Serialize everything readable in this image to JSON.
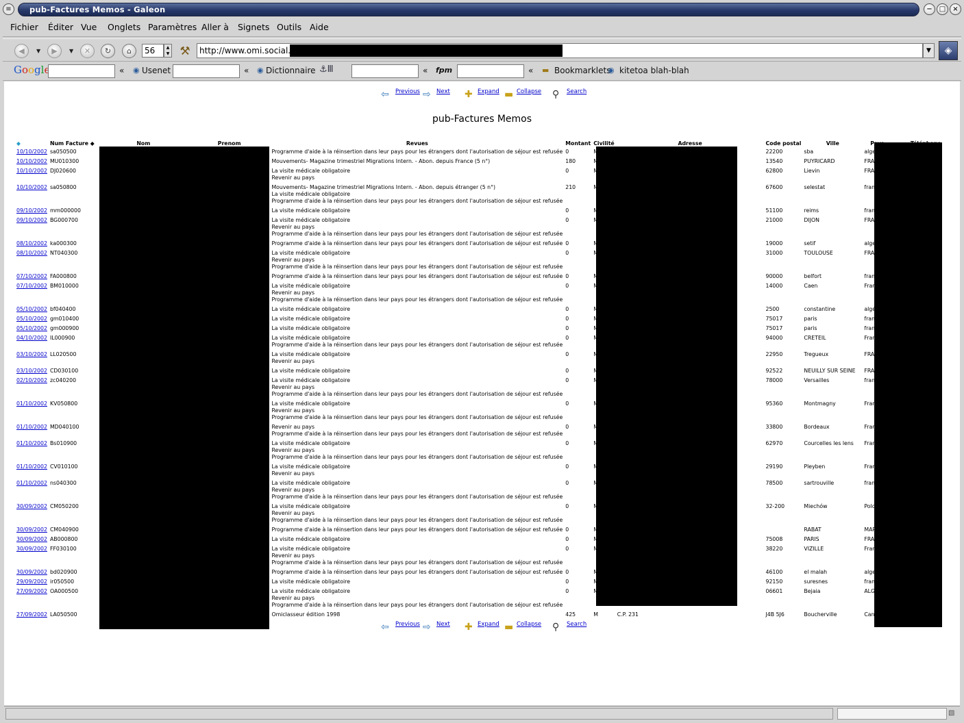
{
  "window": {
    "title": "pub-Factures Memos - Galeon"
  },
  "menu": [
    "Fichier",
    "Éditer",
    "Vue",
    "Onglets",
    "Paramètres",
    "Aller à",
    "Signets",
    "Outils",
    "Aide"
  ],
  "toolbar": {
    "zoom": "56",
    "url": "http://www.omi.social.fr/"
  },
  "bookmarks": {
    "google": "Google",
    "usenet": "Usenet",
    "dictionnaire": "Dictionnaire",
    "fpm": "fpm",
    "chevron": "«",
    "bookmarklets": "Bookmarklets",
    "kitetoa": "kitetoa blah-blah"
  },
  "nav": {
    "previous": "Previous",
    "next": "Next",
    "expand": "Expand",
    "collapse": "Collapse",
    "search": "Search"
  },
  "page_title": "pub-Factures Memos",
  "columns": {
    "num": "Num Facture",
    "nom": "Nom",
    "prenom": "Prenom",
    "revues": "Revues",
    "montant": "Montant",
    "civilite": "Civilité",
    "adresse": "Adresse",
    "cp": "Code postal",
    "ville": "Ville",
    "pays": "Pays",
    "tel": "Téléphone"
  },
  "rows": [
    {
      "date": "10/10/2002",
      "num": "sa050500",
      "revues": [
        "Programme d'aide à la réinsertion dans leur pays pour les étrangers dont l'autorisation de séjour est refusée"
      ],
      "montant": "0",
      "civ": "M",
      "cp": "22200",
      "ville": "sba",
      "pays": "algerie"
    },
    {
      "date": "10/10/2002",
      "num": "MU010300",
      "revues": [
        "Mouvements- Magazine trimestriel Migrations Intern. - Abon. depuis France (5 n°)"
      ],
      "montant": "180",
      "civ": "M",
      "cp": "13540",
      "ville": "PUYRICARD",
      "pays": "FRANCE"
    },
    {
      "date": "10/10/2002",
      "num": "DJ020600",
      "revues": [
        "La visite médicale obligatoire",
        "Revenir au pays"
      ],
      "montant": "0",
      "civ": "M",
      "cp": "62800",
      "ville": "Lievin",
      "pays": "FRANCE"
    },
    {
      "date": "10/10/2002",
      "num": "sa050800",
      "revues": [
        "Mouvements- Magazine trimestriel Migrations Intern. - Abon. depuis étranger (5 n°)",
        "La visite médicale obligatoire",
        "Programme d'aide à la réinsertion dans leur pays pour les étrangers dont l'autorisation de séjour est refusée"
      ],
      "montant": "210",
      "civ": "M",
      "cp": "67600",
      "ville": "selestat",
      "pays": "france"
    },
    {
      "date": "09/10/2002",
      "num": "mm000000",
      "revues": [
        "La visite médicale obligatoire"
      ],
      "montant": "0",
      "civ": "M",
      "cp": "51100",
      "ville": "reims",
      "pays": "france"
    },
    {
      "date": "09/10/2002",
      "num": "BG000700",
      "revues": [
        "La visite médicale obligatoire",
        "Revenir au pays",
        "Programme d'aide à la réinsertion dans leur pays pour les étrangers dont l'autorisation de séjour est refusée"
      ],
      "montant": "0",
      "civ": "Mlle",
      "cp": "21000",
      "ville": "DIJON",
      "pays": "FRANCE"
    },
    {
      "date": "08/10/2002",
      "num": "ka000300",
      "revues": [
        "Programme d'aide à la réinsertion dans leur pays pour les étrangers dont l'autorisation de séjour est refusée"
      ],
      "montant": "0",
      "civ": "M",
      "cp": "19000",
      "ville": "setif",
      "pays": "algerie"
    },
    {
      "date": "08/10/2002",
      "num": "NT040300",
      "revues": [
        "La visite médicale obligatoire",
        "Revenir au pays",
        "Programme d'aide à la réinsertion dans leur pays pour les étrangers dont l'autorisation de séjour est refusée"
      ],
      "montant": "0",
      "civ": "M",
      "cp": "31000",
      "ville": "TOULOUSE",
      "pays": "FRANCE"
    },
    {
      "date": "07/10/2002",
      "num": "FA000800",
      "revues": [
        "Programme d'aide à la réinsertion dans leur pays pour les étrangers dont l'autorisation de séjour est refusée"
      ],
      "montant": "0",
      "civ": "M",
      "cp": "90000",
      "ville": "belfort",
      "pays": "france"
    },
    {
      "date": "07/10/2002",
      "num": "BM010000",
      "revues": [
        "La visite médicale obligatoire",
        "Revenir au pays",
        "Programme d'aide à la réinsertion dans leur pays pour les étrangers dont l'autorisation de séjour est refusée"
      ],
      "montant": "0",
      "civ": "M",
      "cp": "14000",
      "ville": "Caen",
      "pays": "France"
    },
    {
      "date": "05/10/2002",
      "num": "bf040400",
      "revues": [
        "La visite médicale obligatoire"
      ],
      "montant": "0",
      "civ": "M",
      "cp": "2500",
      "ville": "constantine",
      "pays": "algérie"
    },
    {
      "date": "05/10/2002",
      "num": "gm010400",
      "revues": [
        "La visite médicale obligatoire"
      ],
      "montant": "0",
      "civ": "M",
      "cp": "75017",
      "ville": "paris",
      "pays": "france"
    },
    {
      "date": "05/10/2002",
      "num": "gm000900",
      "revues": [
        "La visite médicale obligatoire"
      ],
      "montant": "0",
      "civ": "M",
      "cp": "75017",
      "ville": "paris",
      "pays": "france"
    },
    {
      "date": "04/10/2002",
      "num": "IL000900",
      "revues": [
        "La visite médicale obligatoire",
        "Programme d'aide à la réinsertion dans leur pays pour les étrangers dont l'autorisation de séjour est refusée"
      ],
      "montant": "0",
      "civ": "Mlle",
      "cp": "94000",
      "ville": "CRETEIL",
      "pays": "France"
    },
    {
      "date": "03/10/2002",
      "num": "LL020500",
      "revues": [
        "La visite médicale obligatoire",
        "Revenir au pays"
      ],
      "montant": "0",
      "civ": "M",
      "cp": "22950",
      "ville": "Tregueux",
      "pays": "FRANCE"
    },
    {
      "date": "03/10/2002",
      "num": "CD030100",
      "revues": [
        "La visite médicale obligatoire"
      ],
      "montant": "0",
      "civ": "M",
      "cp": "92522",
      "ville": "NEUILLY SUR SEINE",
      "pays": "FRANCE"
    },
    {
      "date": "02/10/2002",
      "num": "zc040200",
      "revues": [
        "La visite médicale obligatoire",
        "Revenir au pays",
        "Programme d'aide à la réinsertion dans leur pays pour les étrangers dont l'autorisation de séjour est refusée"
      ],
      "montant": "0",
      "civ": "Mlle",
      "cp": "78000",
      "ville": "Versailles",
      "pays": "france"
    },
    {
      "date": "01/10/2002",
      "num": "KV050800",
      "revues": [
        "La visite médicale obligatoire",
        "Revenir au pays",
        "Programme d'aide à la réinsertion dans leur pays pour les étrangers dont l'autorisation de séjour est refusée"
      ],
      "montant": "0",
      "civ": "Mme",
      "cp": "95360",
      "ville": "Montmagny",
      "pays": "France"
    },
    {
      "date": "01/10/2002",
      "num": "MD040100",
      "revues": [
        "Revenir au pays",
        "Programme d'aide à la réinsertion dans leur pays pour les étrangers dont l'autorisation de séjour est refusée"
      ],
      "montant": "0",
      "civ": "Mlle",
      "cp": "33800",
      "ville": "Bordeaux",
      "pays": "France"
    },
    {
      "date": "01/10/2002",
      "num": "Bs010900",
      "revues": [
        "La visite médicale obligatoire",
        "Revenir au pays",
        "Programme d'aide à la réinsertion dans leur pays pour les étrangers dont l'autorisation de séjour est refusée"
      ],
      "montant": "0",
      "civ": "Mme",
      "cp": "62970",
      "ville": "Courcelles les lens",
      "pays": "France"
    },
    {
      "date": "01/10/2002",
      "num": "CV010100",
      "revues": [
        "La visite médicale obligatoire",
        "Revenir au pays"
      ],
      "montant": "0",
      "civ": "M",
      "cp": "29190",
      "ville": "Pleyben",
      "pays": "France"
    },
    {
      "date": "01/10/2002",
      "num": "ns040300",
      "revues": [
        "La visite médicale obligatoire",
        "Revenir au pays",
        "Programme d'aide à la réinsertion dans leur pays pour les étrangers dont l'autorisation de séjour est refusée"
      ],
      "montant": "0",
      "civ": "M",
      "cp": "78500",
      "ville": "sartrouville",
      "pays": "france"
    },
    {
      "date": "30/09/2002",
      "num": "CM050200",
      "revues": [
        "La visite médicale obligatoire",
        "Revenir au pays",
        "Programme d'aide à la réinsertion dans leur pays pour les étrangers dont l'autorisation de séjour est refusée"
      ],
      "montant": "0",
      "civ": "M",
      "cp": "32-200",
      "ville": "Miechów",
      "pays": "Pologne"
    },
    {
      "date": "30/09/2002",
      "num": "CM040900",
      "revues": [
        "Programme d'aide à la réinsertion dans leur pays pour les étrangers dont l'autorisation de séjour est refusée"
      ],
      "montant": "0",
      "civ": "M",
      "cp": "",
      "ville": "RABAT",
      "pays": "MAROC"
    },
    {
      "date": "30/09/2002",
      "num": "AB000800",
      "revues": [
        "La visite médicale obligatoire"
      ],
      "montant": "0",
      "civ": "Mme",
      "cp": "75008",
      "ville": "PARIS",
      "pays": "FRANCE"
    },
    {
      "date": "30/09/2002",
      "num": "FF030100",
      "revues": [
        "La visite médicale obligatoire",
        "Revenir au pays",
        "Programme d'aide à la réinsertion dans leur pays pour les étrangers dont l'autorisation de séjour est refusée"
      ],
      "montant": "0",
      "civ": "M",
      "cp": "38220",
      "ville": "VIZILLE",
      "pays": "France"
    },
    {
      "date": "30/09/2002",
      "num": "bd020900",
      "revues": [
        "Programme d'aide à la réinsertion dans leur pays pour les étrangers dont l'autorisation de séjour est refusée"
      ],
      "montant": "0",
      "civ": "M",
      "cp": "46100",
      "ville": "el malah",
      "pays": "algerie"
    },
    {
      "date": "29/09/2002",
      "num": "ir050500",
      "revues": [
        "La visite médicale obligatoire"
      ],
      "montant": "0",
      "civ": "M",
      "cp": "92150",
      "ville": "suresnes",
      "pays": "france"
    },
    {
      "date": "27/09/2002",
      "num": "OA000500",
      "revues": [
        "La visite médicale obligatoire",
        "Revenir au pays",
        "Programme d'aide à la réinsertion dans leur pays pour les étrangers dont l'autorisation de séjour est refusée"
      ],
      "montant": "0",
      "civ": "M",
      "cp": "06601",
      "ville": "Bejaia",
      "pays": "ALGERIE"
    },
    {
      "date": "27/09/2002",
      "num": "LA050500",
      "revues": [
        "Omiclasseur édition 1998"
      ],
      "montant": "425",
      "civ": "M",
      "adresse": "C.P. 231",
      "cp": "J4B 5J6",
      "ville": "Boucherville",
      "pays": "Canada"
    }
  ]
}
